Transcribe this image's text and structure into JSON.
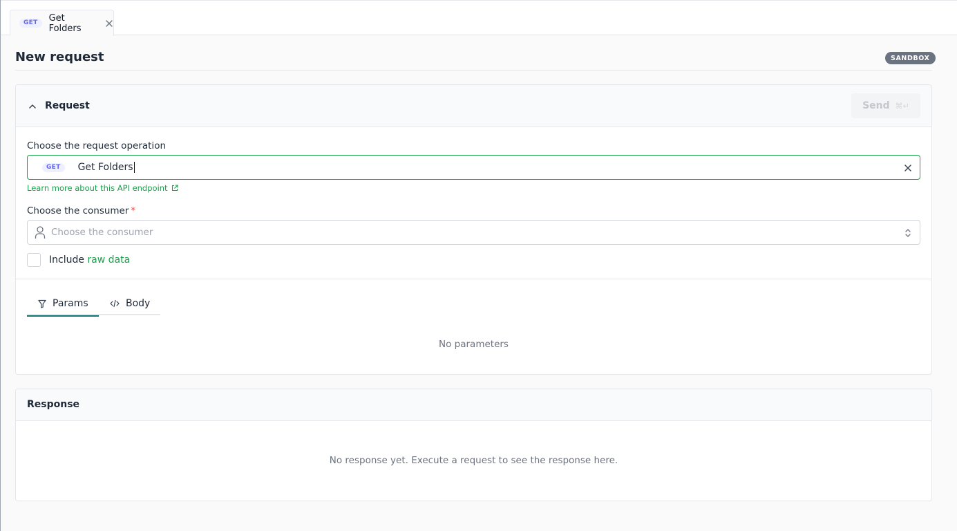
{
  "tab": {
    "method": "GET",
    "label": "Get Folders"
  },
  "header": {
    "title": "New request",
    "badge": "SANDBOX"
  },
  "request": {
    "title": "Request",
    "send_label": "Send",
    "send_shortcut": "⌘↵",
    "operation_label": "Choose the request operation",
    "operation_method": "GET",
    "operation_value": "Get Folders",
    "learn_more": "Learn more about this API endpoint",
    "consumer_label": "Choose the consumer",
    "consumer_required": "*",
    "consumer_placeholder": "Choose the consumer",
    "include_prefix": "Include",
    "include_link": "raw data",
    "tabs": [
      {
        "label": "Params",
        "icon": "filter-icon"
      },
      {
        "label": "Body",
        "icon": "code-icon"
      }
    ],
    "active_tab": "Params",
    "empty_params": "No parameters"
  },
  "response": {
    "title": "Response",
    "empty": "No response yet. Execute a request to see the response here."
  },
  "colors": {
    "accent": "#16a34a",
    "tab_underline": "#0f766e",
    "method_badge": "#6366f1",
    "sandbox_badge": "#6b7280",
    "required": "#ef4444"
  }
}
